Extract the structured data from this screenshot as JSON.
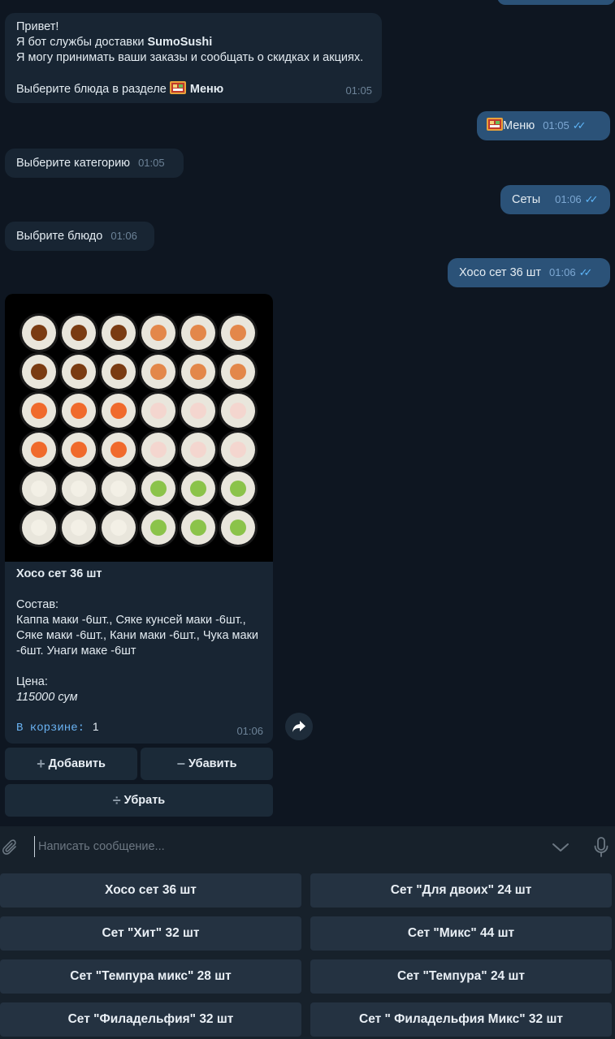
{
  "messages": {
    "greeting_line1": "Привет!",
    "greeting_line2_prefix": "Я бот службы доставки ",
    "greeting_brand": "SumoSushi",
    "greeting_line3": "Я могу принимать ваши заказы и сообщать о скидках и акциях.",
    "greeting_line4_prefix": "Выберите блюда в разделе ",
    "greeting_menu": "Меню",
    "greeting_time": "01:05",
    "out_menu": "Меню",
    "out_menu_time": "01:05",
    "choose_category": "Выберите категорию",
    "choose_category_time": "01:05",
    "out_sets": "Сеты",
    "out_sets_time": "01:06",
    "choose_dish": "Выбрите блюдо",
    "choose_dish_time": "01:06",
    "out_hoso": "Хосо сет 36 шт",
    "out_hoso_time": "01:06"
  },
  "product": {
    "title": "Хосо сет 36 шт",
    "composition_label": "Состав:",
    "composition": "Каппа маки -6шт., Сяке кунсей маки -6шт., Сяке маки -6шт., Кани маки -6шт., Чука маки -6шт. Унаги маке -6шт",
    "price_label": "Цена:",
    "price": "115000 сум",
    "cart_label": "В корзине:",
    "cart_count": "1",
    "time": "01:06"
  },
  "inline_buttons": {
    "add": "Добавить",
    "reduce": "Убавить",
    "remove": "Убрать"
  },
  "composer": {
    "placeholder": "Написать сообщение..."
  },
  "keyboard": [
    "Хосо сет 36 шт",
    "Сет \"Для двоих\" 24 шт",
    "Сет \"Хит\" 32 шт",
    "Сет \"Микс\" 44 шт",
    "Сет \"Темпура микс\" 28 шт",
    "Сет \"Темпура\" 24 шт",
    "Сет \"Филадельфия\" 32 шт",
    "Сет \" Филадельфия Микс\" 32 шт"
  ],
  "icons": [
    "bento-box-icon",
    "double-check-icon",
    "share-icon",
    "plus-icon",
    "minus-icon",
    "divide-icon",
    "paperclip-icon",
    "chevron-down-icon",
    "microphone-icon"
  ],
  "colors": {
    "background": "#0e1621",
    "incoming_bubble": "#182533",
    "outgoing_bubble": "#2b5278",
    "accent": "#5eb5f7"
  }
}
